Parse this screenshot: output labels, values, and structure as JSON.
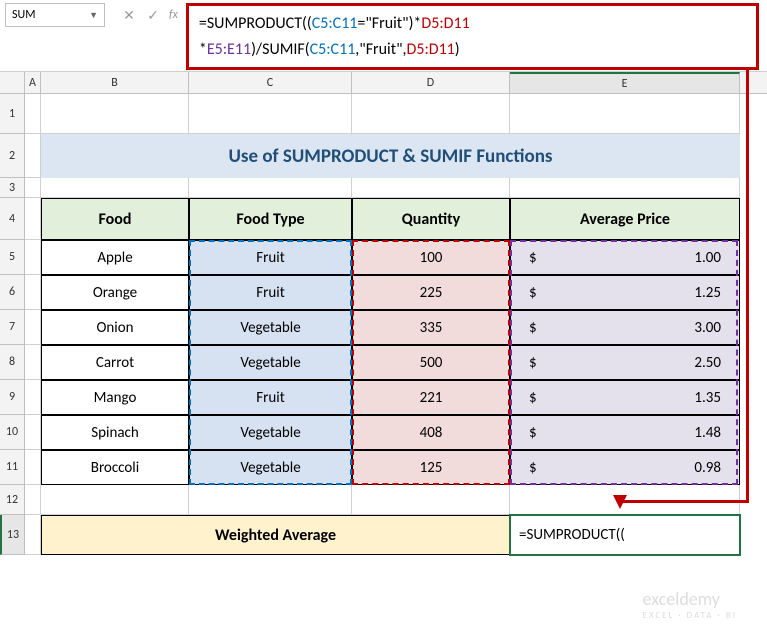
{
  "nameBox": "SUM",
  "formula": {
    "p1": "=SUMPRODUCT((",
    "r1": "C5:C11",
    "p2": "=\"Fruit\")*",
    "r2": "D5:D11",
    "p3": "*",
    "r3": "E5:E11",
    "p4": ")/SUMIF(",
    "r4": "C5:C11",
    "p5": ",\"Fruit\",",
    "r5": "D5:D11",
    "p6": ")"
  },
  "cols": {
    "A": "A",
    "B": "B",
    "C": "C",
    "D": "D",
    "E": "E"
  },
  "rows": [
    "1",
    "2",
    "3",
    "4",
    "5",
    "6",
    "7",
    "8",
    "9",
    "10",
    "11",
    "12",
    "13"
  ],
  "title": "Use of SUMPRODUCT & SUMIF Functions",
  "headers": {
    "food": "Food",
    "type": "Food Type",
    "qty": "Quantity",
    "price": "Average Price"
  },
  "data": [
    {
      "food": "Apple",
      "type": "Fruit",
      "qty": "100",
      "price": "1.00"
    },
    {
      "food": "Orange",
      "type": "Fruit",
      "qty": "225",
      "price": "1.25"
    },
    {
      "food": "Onion",
      "type": "Vegetable",
      "qty": "335",
      "price": "3.00"
    },
    {
      "food": "Carrot",
      "type": "Vegetable",
      "qty": "500",
      "price": "2.50"
    },
    {
      "food": "Mango",
      "type": "Fruit",
      "qty": "221",
      "price": "1.35"
    },
    {
      "food": "Spinach",
      "type": "Vegetable",
      "qty": "408",
      "price": "1.48"
    },
    {
      "food": "Broccoli",
      "type": "Vegetable",
      "qty": "125",
      "price": "0.98"
    }
  ],
  "currency": "$",
  "wa_label": "Weighted Average",
  "wa_entry": "=SUMPRODUCT((",
  "watermark": "exceldemy",
  "watermark_sub": "EXCEL · DATA · BI"
}
